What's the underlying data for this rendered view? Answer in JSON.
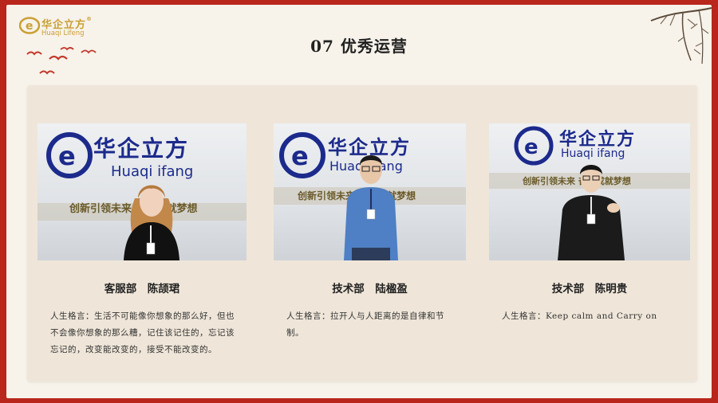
{
  "brand": {
    "cn": "华企立方",
    "en": "Huaqi Lifeng",
    "registered": "®"
  },
  "page": {
    "title": "07 优秀运营"
  },
  "photo_wall": {
    "cn": "华企立方",
    "en": "Huaqi  ifang",
    "slogan": "创新引领未来  奋斗成就梦想"
  },
  "colors": {
    "border": "#b8261c",
    "gold": "#c9a033",
    "brand_blue": "#1c2a8c",
    "panel": "#efe6d9"
  },
  "cards": [
    {
      "name": "客服部　陈颉珺",
      "motto": "人生格言：生活不可能像你想象的那么好，但也不会像你想象的那么糟，记住该记住的，忘记该忘记的，改变能改变的，接受不能改变的。"
    },
    {
      "name": "技术部　陆楹盈",
      "motto": "人生格言：拉开人与人距离的是自律和节制。"
    },
    {
      "name": "技术部　陈明贵",
      "motto": "人生格言：Keep calm and Carry on"
    }
  ]
}
